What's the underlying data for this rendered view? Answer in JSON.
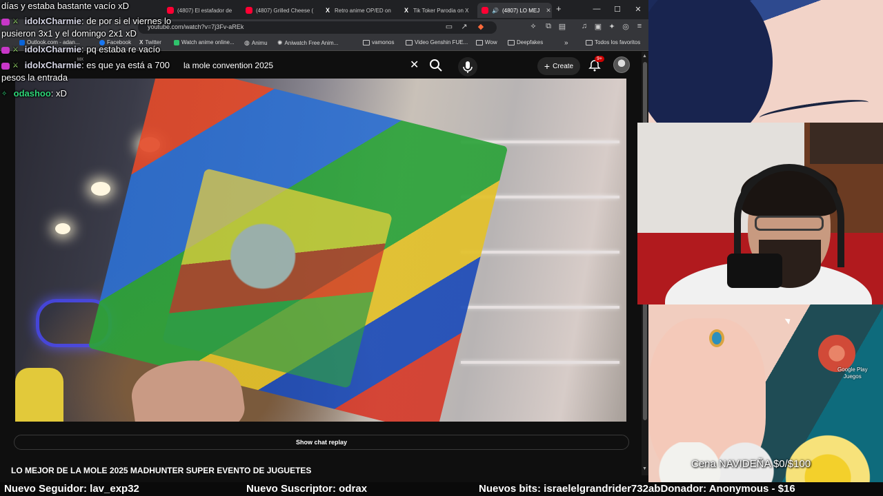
{
  "browser": {
    "tabs": [
      {
        "label": "(4807) El estafador de",
        "icon": "youtube-icon"
      },
      {
        "label": "(4807) Grilled Cheese (",
        "icon": "youtube-icon"
      },
      {
        "label": "Retro anime OP/ED on",
        "icon": "x-icon"
      },
      {
        "label": "Tik Toker Parodia on X",
        "icon": "x-icon"
      },
      {
        "label": "(4807) LO MEJ",
        "icon": "youtube-icon",
        "active": true
      }
    ],
    "new_tab": "+",
    "url": "youtube.com/watch?v=7j3Fv-aREk",
    "bookmarks": [
      "Outlook.com - adan...",
      "Facebook",
      "Twitter",
      "Watch anime online...",
      "Animu",
      "Aniwatch Free Anim...",
      "vamonos",
      "Video Genshin FUE...",
      "Wow",
      "Deepfakes",
      "Todos los favoritos"
    ]
  },
  "youtube": {
    "logo_partial": "MX",
    "search_query": "la mole convention 2025",
    "create_label": "Create",
    "notification_count": "9+",
    "show_chat_replay": "Show chat replay",
    "video_title": "LO MEJOR DE LA MOLE 2025 MADHUNTER SUPER EVENTO DE JUGUETES"
  },
  "chat": [
    {
      "user": "",
      "text": "días y estaba bastante vacío xD"
    },
    {
      "user": "idolxCharmie",
      "text": "de por si el viernes lo"
    },
    {
      "user": "",
      "text": "pusieron 3x1 y el domingo 2x1 xD"
    },
    {
      "user": "idolxCharmie",
      "text": "pq estaba re vacío"
    },
    {
      "user": "idolxCharmie",
      "text": "es que ya está a 700"
    },
    {
      "user": "",
      "text": "pesos la entrada"
    },
    {
      "user": "odashoo",
      "text": "xD"
    }
  ],
  "overlay": {
    "google_play_label": "Google Play",
    "google_play_sub": "Juegos",
    "goal": "Cena NAVIDEÑA $0/$100"
  },
  "ticker": {
    "follower": "Nuevo Seguidor: lav_exp32",
    "subscriber": "Nuevo Suscriptor: odrax",
    "bits": "Nuevos bits: israelelgrandrider732abDonador: Anonymous - $16"
  }
}
